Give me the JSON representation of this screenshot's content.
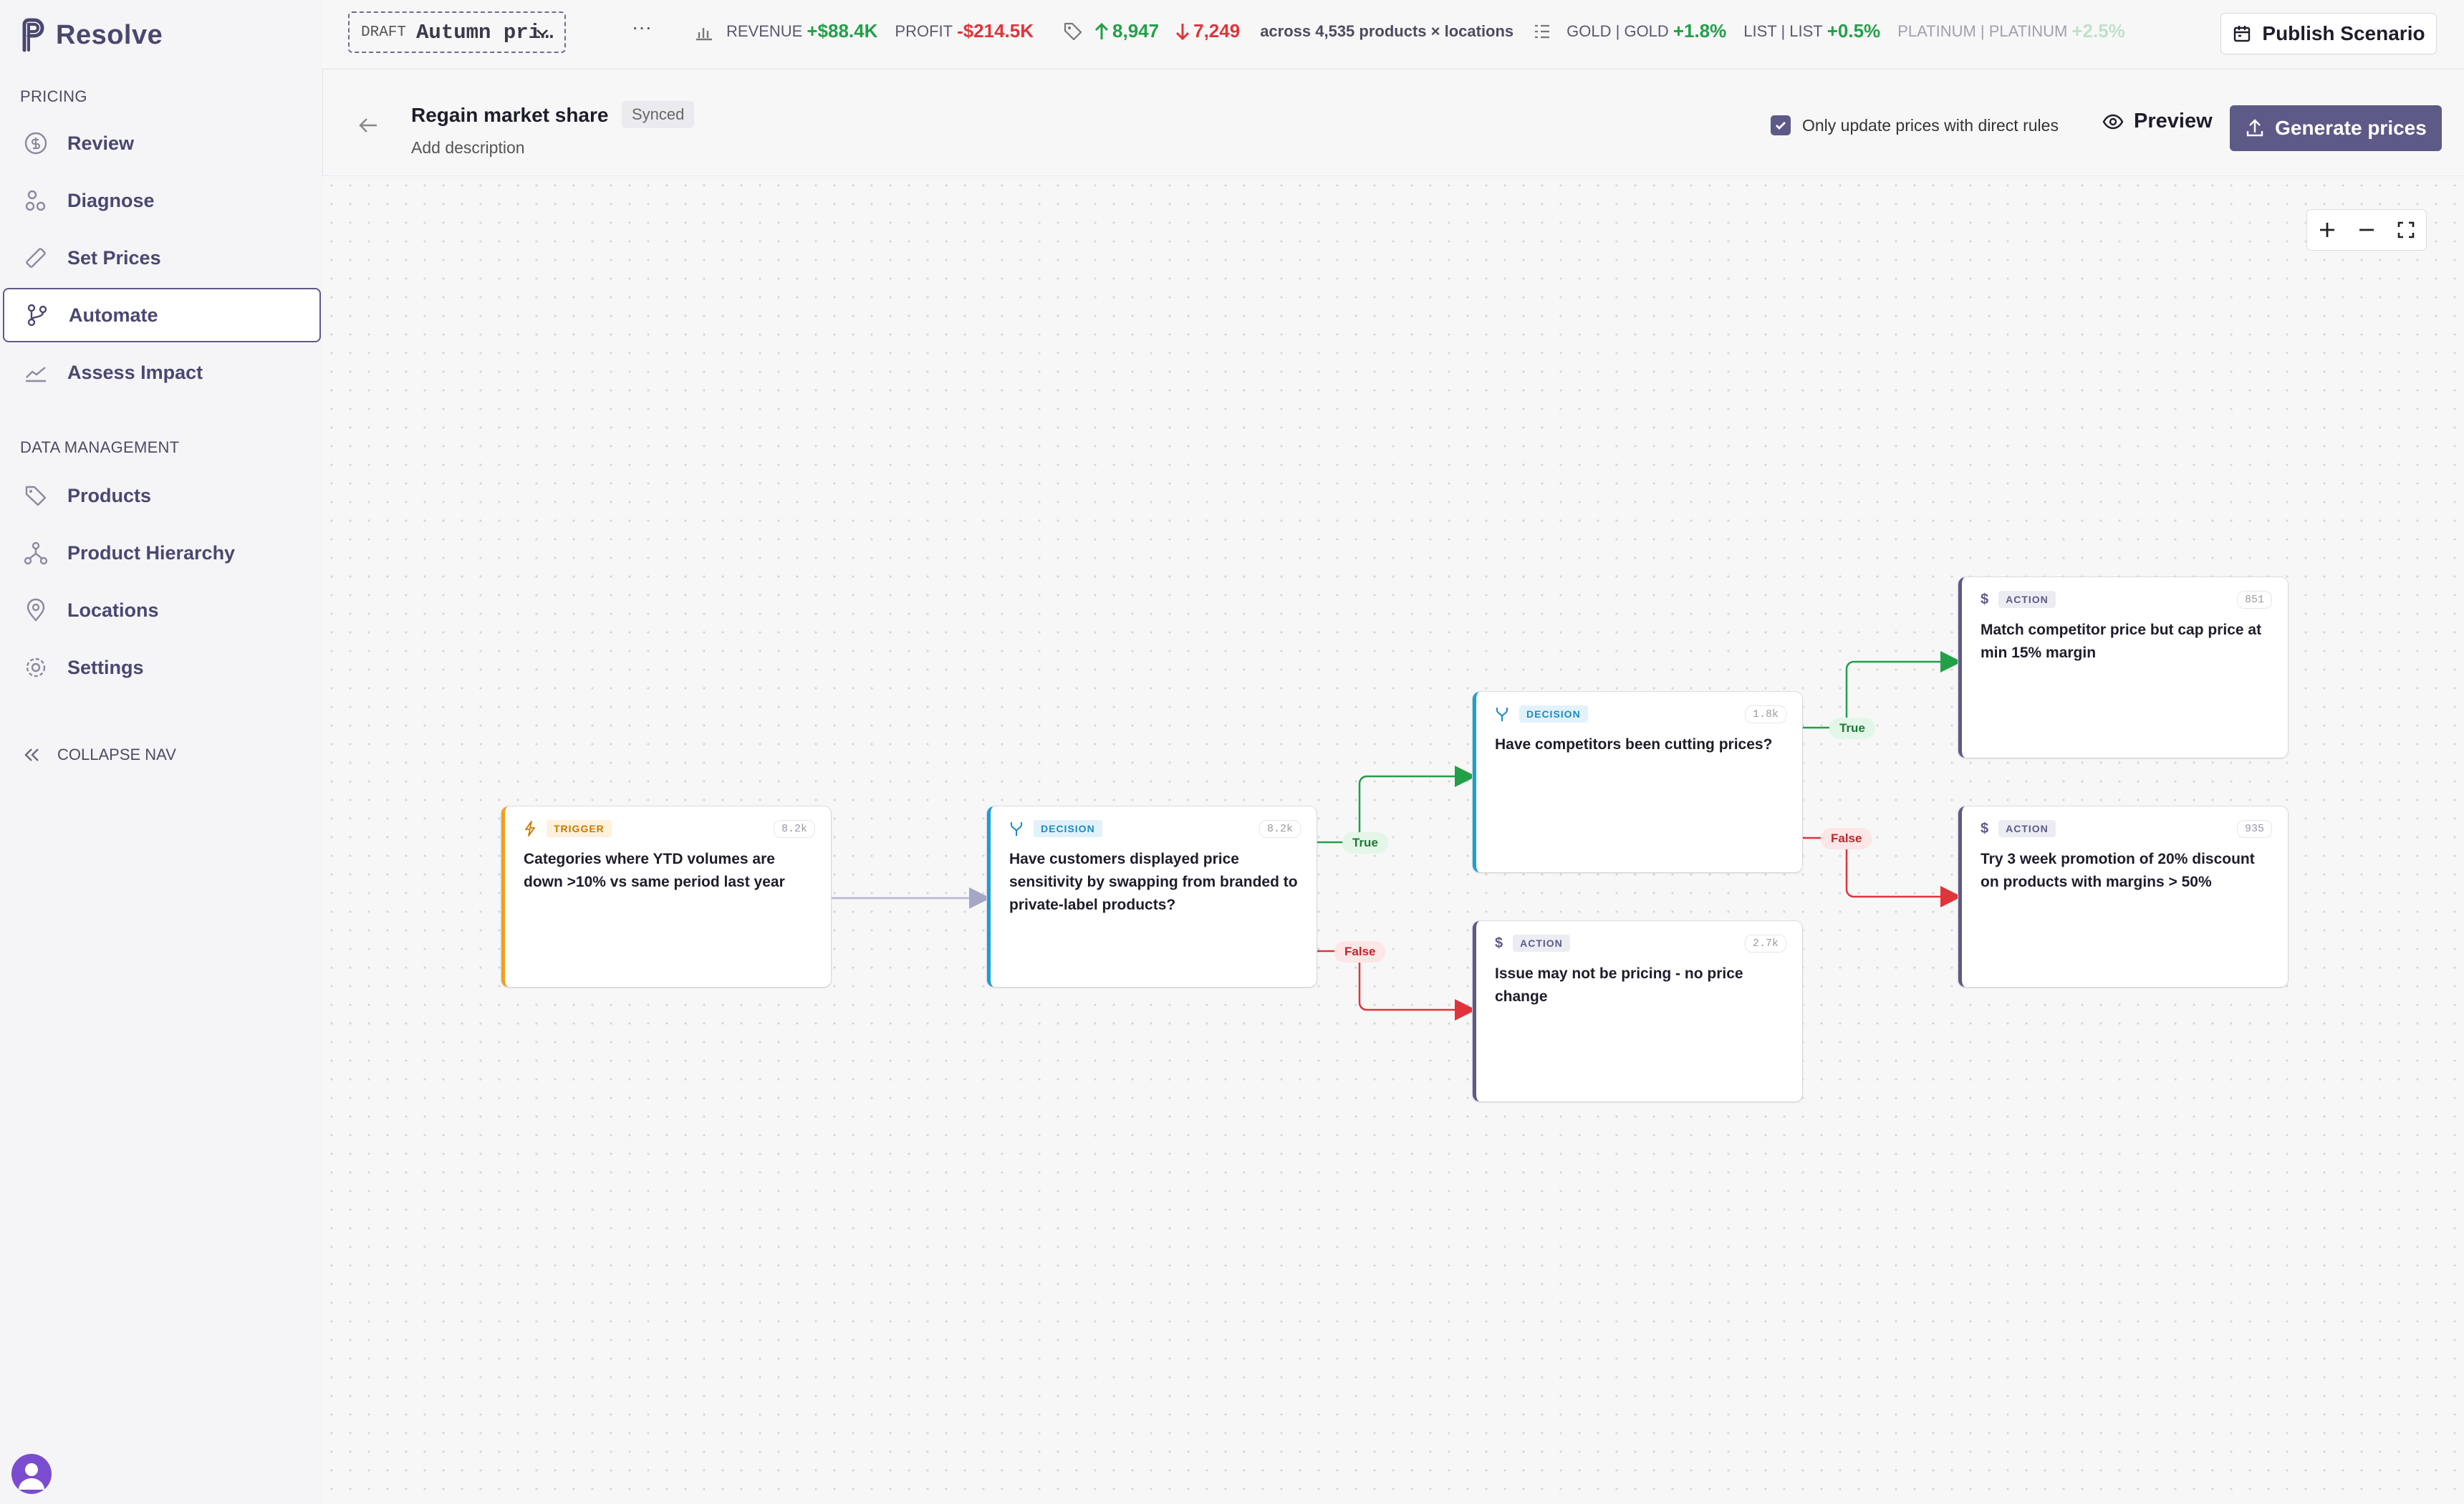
{
  "app": {
    "name": "Resolve"
  },
  "sidebar": {
    "pricing_label": "PRICING",
    "pricing_items": [
      {
        "label": "Review",
        "icon": "dollar-circle-icon"
      },
      {
        "label": "Diagnose",
        "icon": "diagnose-icon"
      },
      {
        "label": "Set Prices",
        "icon": "ruler-icon"
      },
      {
        "label": "Automate",
        "icon": "branch-icon",
        "active": true
      },
      {
        "label": "Assess Impact",
        "icon": "chart-line-icon"
      }
    ],
    "data_label": "DATA MANAGEMENT",
    "data_items": [
      {
        "label": "Products",
        "icon": "tags-icon"
      },
      {
        "label": "Product Hierarchy",
        "icon": "hierarchy-icon"
      },
      {
        "label": "Locations",
        "icon": "map-pin-icon"
      },
      {
        "label": "Settings",
        "icon": "gear-icon"
      }
    ],
    "collapse_label": "COLLAPSE NAV"
  },
  "topbar": {
    "scenario_status": "DRAFT",
    "scenario_name": "Autumn pri…",
    "more": "···",
    "revenue_label": "REVENUE",
    "revenue_value": "+$88.4K",
    "profit_label": "PROFIT",
    "profit_value": "-$214.5K",
    "up_count": "8,947",
    "down_count": "7,249",
    "scope": "across 4,535 products × locations",
    "tier1_label": "GOLD | GOLD",
    "tier1_value": "+1.8%",
    "tier2_label": "LIST | LIST",
    "tier2_value": "+0.5%",
    "tier3_label": "PLATINUM | PLATINUM",
    "tier3_value": "+2.5%",
    "publish_label": "Publish Scenario"
  },
  "header": {
    "title": "Regain market share",
    "sync_status": "Synced",
    "description_placeholder": "Add description",
    "checkbox_label": "Only update prices with direct rules",
    "checkbox_checked": true,
    "preview_label": "Preview",
    "generate_label": "Generate prices"
  },
  "flow": {
    "nodes": [
      {
        "id": "trigger",
        "type": "TRIGGER",
        "count": "8.2k",
        "text": "Categories where YTD volumes are down >10% vs same period last year"
      },
      {
        "id": "decision1",
        "type": "DECISION",
        "count": "8.2k",
        "text": "Have customers displayed price sensitivity by swapping from branded to private-label products?"
      },
      {
        "id": "decision2",
        "type": "DECISION",
        "count": "1.8k",
        "text": "Have competitors been cutting prices?"
      },
      {
        "id": "action1",
        "type": "ACTION",
        "count": "2.7k",
        "text": "Issue may not be pricing - no price change"
      },
      {
        "id": "action2",
        "type": "ACTION",
        "count": "851",
        "text": "Match competitor price but cap price at min 15% margin"
      },
      {
        "id": "action3",
        "type": "ACTION",
        "count": "935",
        "text": "Try 3 week promotion of 20% discount on products with margins > 50%"
      }
    ],
    "true_label": "True",
    "false_label": "False"
  },
  "colors": {
    "brand": "#5d5a88",
    "positive": "#22a048",
    "negative": "#e0343a",
    "trigger": "#f4a01a",
    "decision": "#1a9fd9"
  }
}
